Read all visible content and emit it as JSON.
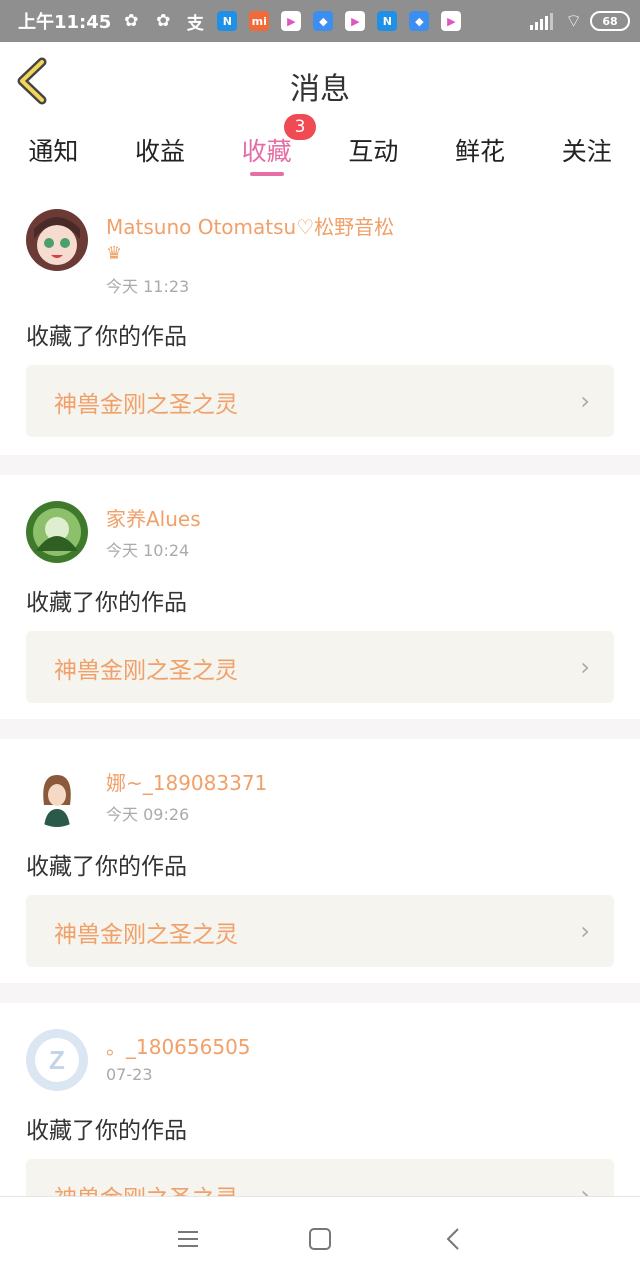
{
  "status_bar": {
    "time": "上午11:45",
    "battery": "68",
    "icons": [
      {
        "name": "wechat-icon",
        "glyph": "✿",
        "color": "#8f8f8f"
      },
      {
        "name": "wechat-icon",
        "glyph": "✿",
        "color": "#8f8f8f"
      },
      {
        "name": "alipay-icon",
        "glyph": "支",
        "color": "#8f8f8f"
      },
      {
        "name": "n-app-icon",
        "glyph": "N",
        "color": "#1e90e6"
      },
      {
        "name": "mi-app-icon",
        "glyph": "mi",
        "color": "#f06a3a"
      },
      {
        "name": "play-app-icon",
        "glyph": "▶",
        "color": "#ffffff"
      },
      {
        "name": "blue-app-icon",
        "glyph": "◆",
        "color": "#3c8ef0"
      },
      {
        "name": "play-app-icon",
        "glyph": "▶",
        "color": "#ffffff"
      },
      {
        "name": "n-app-icon",
        "glyph": "N",
        "color": "#1e90e6"
      },
      {
        "name": "blue-app-icon",
        "glyph": "◆",
        "color": "#3c8ef0"
      },
      {
        "name": "play-app-icon",
        "glyph": "▶",
        "color": "#ffffff"
      }
    ]
  },
  "header": {
    "title": "消息"
  },
  "tabs": [
    {
      "label": "通知"
    },
    {
      "label": "收益"
    },
    {
      "label": "收藏",
      "badge": "3",
      "active": true
    },
    {
      "label": "互动"
    },
    {
      "label": "鲜花"
    },
    {
      "label": "关注"
    }
  ],
  "items": [
    {
      "user": "Matsuno Otomatsu♡松野音松",
      "crown": "♛",
      "time": "今天 11:23",
      "action": "收藏了你的作品",
      "work": "神兽金刚之圣之灵"
    },
    {
      "user": "家养Alues",
      "time": "今天 10:24",
      "action": "收藏了你的作品",
      "work": "神兽金刚之圣之灵"
    },
    {
      "user": "娜~_189083371",
      "time": "今天 09:26",
      "action": "收藏了你的作品",
      "work": "神兽金刚之圣之灵"
    },
    {
      "user": "。_180656505",
      "time": "07-23",
      "action": "收藏了你的作品",
      "work": "神兽金刚之圣之灵"
    }
  ],
  "colors": {
    "accent": "#e56ea6",
    "username": "#f0a068",
    "badge": "#f04a55"
  }
}
